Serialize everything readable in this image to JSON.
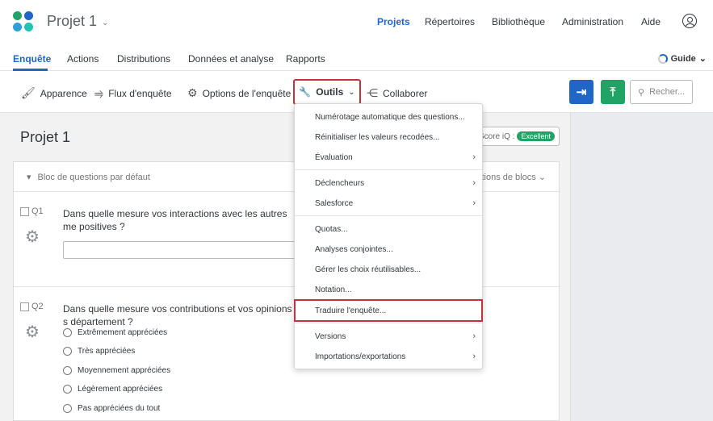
{
  "app": {
    "project_title": "Projet 1",
    "nav": [
      "Projets",
      "Répertoires",
      "Bibliothèque",
      "Administration",
      "Aide"
    ]
  },
  "tabs": [
    "Enquête",
    "Actions",
    "Distributions",
    "Données et analyse",
    "Rapports"
  ],
  "guide_label": "Guide",
  "toolbar": {
    "appearance": "Apparence",
    "flow": "Flux d'enquête",
    "options": "Options de l'enquête",
    "tools": "Outils",
    "collaborate": "Collaborer",
    "search_placeholder": "Recher..."
  },
  "survey": {
    "title": "Projet 1",
    "score_label": "Score iQ :",
    "score_value": "Excellent",
    "block_label": "Bloc de questions par défaut",
    "block_options": "tions de blocs"
  },
  "questions": [
    {
      "num": "Q1",
      "text": "Dans quelle mesure vos interactions avec les autres me positives ?"
    },
    {
      "num": "Q2",
      "text": "Dans quelle mesure vos contributions et vos opinions s département ?",
      "choices": [
        "Extrêmement appréciées",
        "Très appréciées",
        "Moyennement appréciées",
        "Légèrement appréciées",
        "Pas appréciées du tout"
      ]
    }
  ],
  "menu": [
    {
      "label": "Numérotage automatique des questions...",
      "arrow": false
    },
    {
      "label": "Réinitialiser les valeurs recodées...",
      "arrow": false
    },
    {
      "label": "Évaluation",
      "arrow": true
    },
    {
      "label": "Déclencheurs",
      "arrow": true
    },
    {
      "label": "Salesforce",
      "arrow": true
    },
    {
      "label": "Quotas...",
      "arrow": false
    },
    {
      "label": "Analyses conjointes...",
      "arrow": false
    },
    {
      "label": "Gérer les choix réutilisables...",
      "arrow": false
    },
    {
      "label": "Notation...",
      "arrow": false
    },
    {
      "label": "Traduire l'enquête...",
      "arrow": false,
      "highlighted": true
    },
    {
      "label": "Versions",
      "arrow": true
    },
    {
      "label": "Importations/exportations",
      "arrow": true
    }
  ],
  "colors": {
    "accent": "#1f66c7",
    "success": "#21a366",
    "highlight": "#c0343f"
  }
}
